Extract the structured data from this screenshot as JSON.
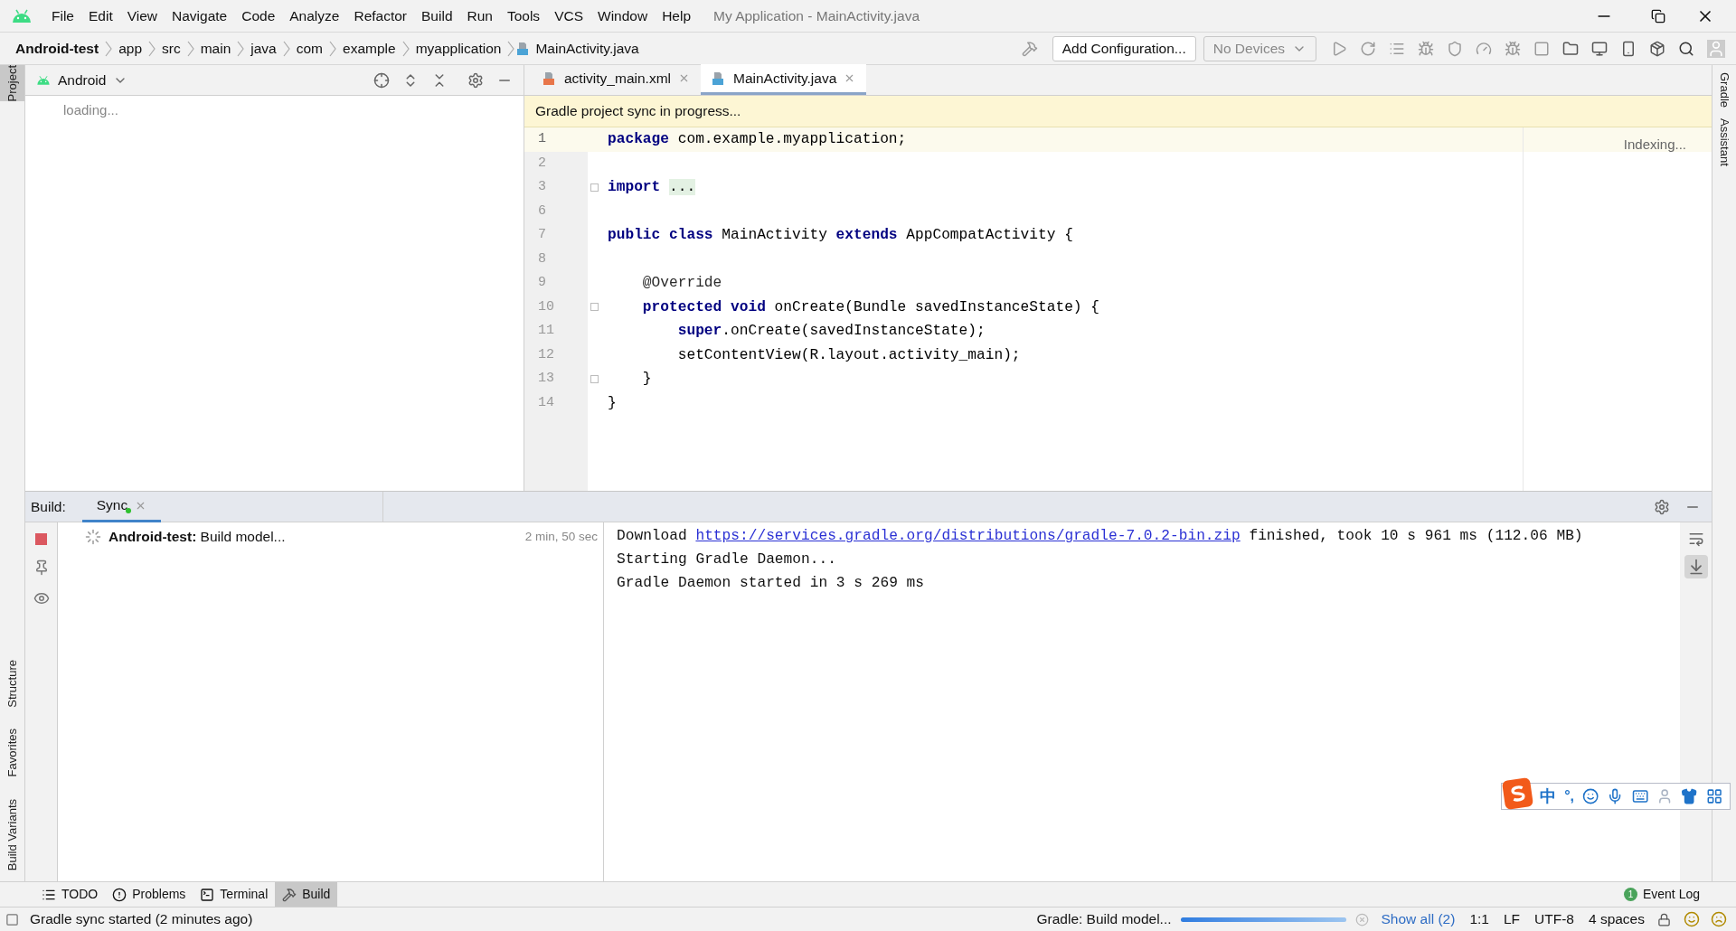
{
  "title_bar": {
    "menu": [
      "File",
      "Edit",
      "View",
      "Navigate",
      "Code",
      "Analyze",
      "Refactor",
      "Build",
      "Run",
      "Tools",
      "VCS",
      "Window",
      "Help"
    ],
    "title": "My Application - MainActivity.java"
  },
  "navigation_bar": {
    "breadcrumbs": [
      {
        "label": "Android-test",
        "kind": "project"
      },
      {
        "label": "app",
        "kind": "folder"
      },
      {
        "label": "src",
        "kind": "folder"
      },
      {
        "label": "main",
        "kind": "folder"
      },
      {
        "label": "java",
        "kind": "folder"
      },
      {
        "label": "com",
        "kind": "folder"
      },
      {
        "label": "example",
        "kind": "folder"
      },
      {
        "label": "myapplication",
        "kind": "folder"
      },
      {
        "label": "MainActivity.java",
        "kind": "file"
      }
    ],
    "run_config": "Add Configuration...",
    "device": "No Devices"
  },
  "left_stripe": {
    "top": [
      "Project"
    ],
    "bottom": [
      "Structure",
      "Favorites",
      "Build Variants"
    ]
  },
  "right_stripe": [
    "Gradle",
    "Assistant"
  ],
  "project_panel": {
    "view": "Android",
    "status": "loading..."
  },
  "editor": {
    "tabs": [
      {
        "label": "activity_main.xml",
        "kind": "xml",
        "selected": false
      },
      {
        "label": "MainActivity.java",
        "kind": "java",
        "selected": true
      }
    ],
    "banner": "Gradle project sync in progress...",
    "status": "Indexing...",
    "lines": [
      {
        "number": "1",
        "current": true,
        "fold": false,
        "tokens": [
          {
            "text": "package",
            "kind": "keyword"
          },
          {
            "text": " com.example.myapplication;",
            "kind": "plain"
          }
        ]
      },
      {
        "number": "2",
        "current": false,
        "fold": false
      },
      {
        "number": "3",
        "current": false,
        "fold": true,
        "tokens": [
          {
            "text": "import ",
            "kind": "keyword"
          },
          {
            "text": "...",
            "kind": "folded"
          }
        ]
      },
      {
        "number": "6",
        "current": false,
        "fold": false
      },
      {
        "number": "7",
        "current": false,
        "fold": false,
        "tokens": [
          {
            "text": "public class",
            "kind": "keyword"
          },
          {
            "text": " MainActivity ",
            "kind": "plain"
          },
          {
            "text": "extends",
            "kind": "keyword"
          },
          {
            "text": " AppCompatActivity {",
            "kind": "plain"
          }
        ]
      },
      {
        "number": "8",
        "current": false,
        "fold": false
      },
      {
        "number": "9",
        "current": false,
        "fold": false,
        "tokens": [
          {
            "text": "    @Override",
            "kind": "annotation"
          }
        ]
      },
      {
        "number": "10",
        "current": false,
        "fold": true,
        "tokens": [
          {
            "text": "    protected void",
            "kind": "keyword"
          },
          {
            "text": " onCreate(Bundle savedInstanceState) {",
            "kind": "plain"
          }
        ]
      },
      {
        "number": "11",
        "current": false,
        "fold": false,
        "tokens": [
          {
            "text": "        super",
            "kind": "keyword"
          },
          {
            "text": ".onCreate(savedInstanceState);",
            "kind": "plain"
          }
        ]
      },
      {
        "number": "12",
        "current": false,
        "fold": false,
        "tokens": [
          {
            "text": "        setContentView(R.layout.activity_main);",
            "kind": "plain"
          }
        ]
      },
      {
        "number": "13",
        "current": false,
        "fold": true,
        "tokens": [
          {
            "text": "    }",
            "kind": "plain"
          }
        ]
      },
      {
        "number": "14",
        "current": false,
        "fold": false,
        "tokens": [
          {
            "text": "}",
            "kind": "plain"
          }
        ]
      }
    ]
  },
  "build_panel": {
    "title": "Build:",
    "tabs": [
      {
        "label": "Sync",
        "selected": true,
        "running": true
      }
    ],
    "tree": [
      {
        "project": "Android-test:",
        "task": "Build model...",
        "time": "2 min, 50 sec"
      }
    ],
    "log": [
      {
        "kind": "link",
        "before": "Download ",
        "link": "https://services.gradle.org/distributions/gradle-7.0.2-bin.zip",
        "after": " finished, took 10 s 961 ms (112.06 MB)"
      },
      {
        "kind": "text",
        "text": "Starting Gradle Daemon..."
      },
      {
        "kind": "text",
        "text": "Gradle Daemon started in 3 s 269 ms"
      }
    ]
  },
  "tool_tabs": [
    {
      "label": "TODO",
      "kind": "todo",
      "selected": false
    },
    {
      "label": "Problems",
      "kind": "problems",
      "selected": false
    },
    {
      "label": "Terminal",
      "kind": "terminal",
      "selected": false
    },
    {
      "label": "Build",
      "kind": "build",
      "selected": true
    }
  ],
  "event_log": {
    "label": "Event Log",
    "count": "1"
  },
  "status_bar": {
    "message": "Gradle sync started (2 minutes ago)",
    "task": "Gradle: Build model...",
    "progress": {
      "level": 1
    },
    "show_all": "Show all (2)",
    "position": "1:1",
    "line_separator": "LF",
    "encoding": "UTF-8",
    "indent": "4 spaces"
  },
  "ime_toolbar": {
    "mode": "中",
    "punctuation": "°,"
  }
}
